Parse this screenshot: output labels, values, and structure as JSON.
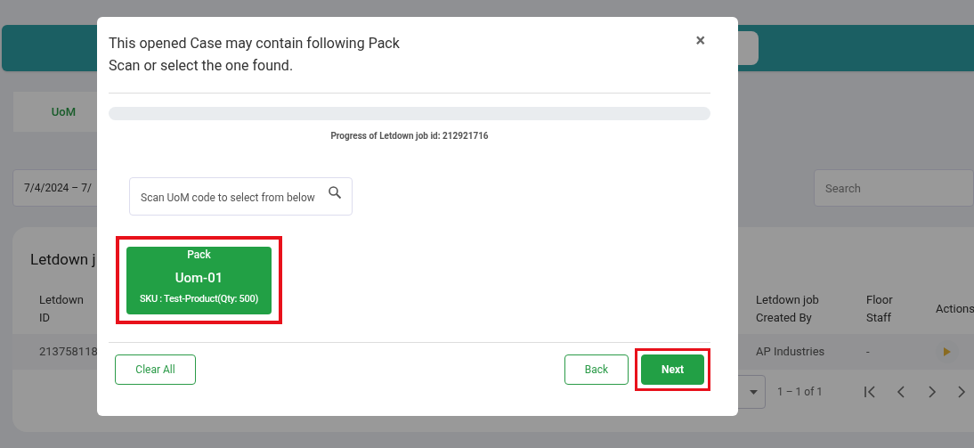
{
  "background": {
    "tabs": [
      {
        "label": "UoM",
        "selected": true
      }
    ],
    "date_range": {
      "value": "7/4/2024 – 7/"
    },
    "search": {
      "placeholder": "Search"
    },
    "card": {
      "title": "Letdown j",
      "columns": [
        "Letdown ID",
        "Letdown job Created By",
        "Floor Staff",
        "Actions"
      ],
      "rows": [
        {
          "cells": [
            "213758118",
            "AP Industries",
            "-"
          ]
        }
      ],
      "pagination": {
        "range": "1 – 1 of 1"
      }
    }
  },
  "modal": {
    "title_lines": [
      "This opened Case may contain following Pack",
      "Scan or select the one found."
    ],
    "close": "×",
    "progress": {
      "level": 0,
      "label": "Progress of Letdown job id: 212921716"
    },
    "scan_field": {
      "placeholder": "Scan UoM code to select from below"
    },
    "uom_cards": [
      {
        "type": "Pack",
        "code": "Uom-01",
        "detail": "SKU : Test-Product(Qty: 500)",
        "highlighted": true
      }
    ],
    "buttons": [
      {
        "label": "Clear All",
        "kind": "outline",
        "highlighted": false
      },
      {
        "label": "Back",
        "kind": "outline",
        "highlighted": false
      },
      {
        "label": "Next",
        "kind": "primary",
        "highlighted": true
      }
    ]
  }
}
